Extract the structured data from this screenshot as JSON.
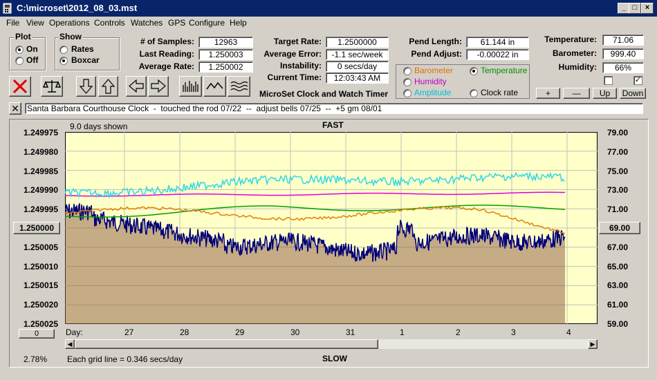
{
  "window": {
    "title": "C:\\microset\\2012_08_03.mst"
  },
  "menu": [
    "File",
    "View",
    "Operations",
    "Controls",
    "Watches",
    "GPS",
    "Configure",
    "Help"
  ],
  "plot_group": {
    "title": "Plot",
    "on": "On",
    "off": "Off",
    "selected": "On"
  },
  "show_group": {
    "title": "Show",
    "rates": "Rates",
    "boxcar": "Boxcar",
    "selected": "Boxcar"
  },
  "stats": {
    "samples_label": "# of Samples:",
    "samples": "12963",
    "last_reading_label": "Last Reading:",
    "last_reading": "1.250003",
    "average_rate_label": "Average Rate:",
    "average_rate": "1.250002",
    "target_rate_label": "Target Rate:",
    "target_rate": "1.2500000",
    "average_error_label": "Average Error:",
    "average_error": "-1.1 sec/week",
    "instability_label": "Instability:",
    "instability": "0 secs/day",
    "current_time_label": "Current Time:",
    "current_time": "12:03:43 AM",
    "pend_length_label": "Pend Length:",
    "pend_length": "61.144 in",
    "pend_adjust_label": "Pend Adjust:",
    "pend_adjust": "-0.00022 in",
    "temperature_label": "Temperature:",
    "temperature": "71.06",
    "barometer_label": "Barometer:",
    "barometer": "999.40",
    "humidity_label": "Humidity:",
    "humidity": "66%"
  },
  "app_name": "MicroSet Clock and Watch Timer",
  "right_axis_options": {
    "barometer": "Barometer",
    "temperature": "Temperature",
    "humidity": "Humidity",
    "amplitude": "Amplitude",
    "clock_rate": "Clock rate",
    "selected": "Temperature",
    "colors": {
      "barometer": "#e07000",
      "temperature": "#009000",
      "humidity": "#c000c0",
      "amplitude": "#00c0d0",
      "clock_rate": "#000000"
    }
  },
  "scale_buttons": {
    "plus": "+",
    "minus": "—",
    "up": "Up",
    "down": "Down"
  },
  "notes": "Santa Barbara Courthouse Clock  -  touched the rod 07/22  --  adjust bells 07/25  --  +5 gm 08/01",
  "graph": {
    "days_shown": "9.0 days shown",
    "fast": "FAST",
    "slow": "SLOW",
    "grid_note": "Each grid line = 0.346 secs/day",
    "percent": "2.78%",
    "center_left": "1.250000",
    "center_right": "69.00",
    "bottom_left_btn": "0",
    "day_label": "Day:",
    "left_ticks": [
      "1.249975",
      "1.249980",
      "1.249985",
      "1.249990",
      "1.249995",
      "",
      "1.250005",
      "1.250010",
      "1.250015",
      "1.250020",
      "1.250025"
    ],
    "right_ticks": [
      "79.00",
      "77.00",
      "75.00",
      "73.00",
      "71.00",
      "",
      "67.00",
      "65.00",
      "63.00",
      "61.00",
      "59.00"
    ],
    "days": [
      "27",
      "28",
      "29",
      "30",
      "31",
      "1",
      "2",
      "3",
      "4"
    ],
    "colors": {
      "plot_bg": "#ffffc8",
      "grid": "#c0c0c0",
      "rate": "#00007a",
      "boxcar": "#8b5a40",
      "temperature": "#00a000",
      "humidity": "#e000e0",
      "amplitude": "#30d8e8",
      "barometer": "#e08000"
    }
  }
}
